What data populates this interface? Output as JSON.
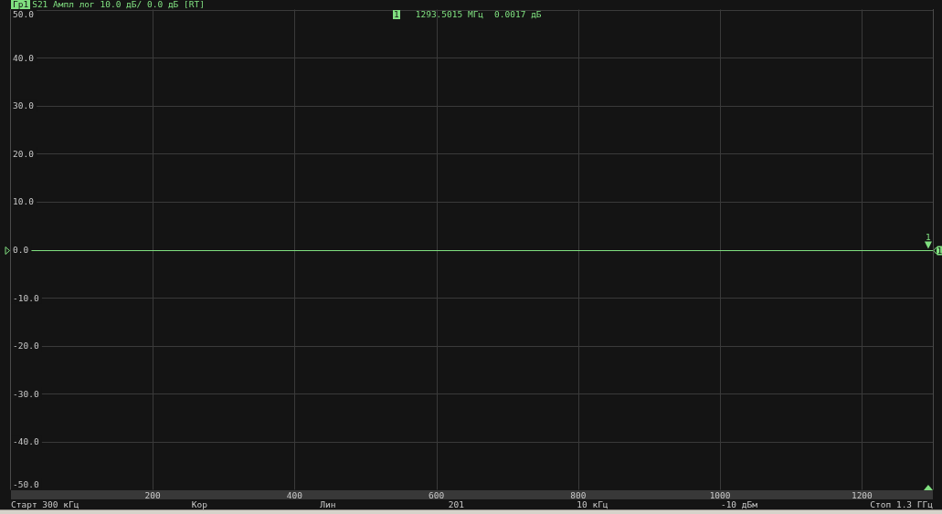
{
  "header": {
    "channel": "Гр1",
    "trace": "S21 Ампл лог 10.0 дБ/ 0.0 дБ [RT]"
  },
  "marker_readout": {
    "marker": "1",
    "stimulus": "1293.5015 МГц",
    "response": "0.0017 дБ"
  },
  "plot": {
    "chart_data": {
      "type": "line",
      "x": [
        0.3,
        1300
      ],
      "series": [
        {
          "color": "#80e080",
          "values": [
            0,
            0
          ]
        }
      ],
      "xlim": [
        0.3,
        1300
      ],
      "ylim": [
        -50,
        50
      ],
      "xticks": [
        200,
        400,
        600,
        800,
        1000,
        1200
      ],
      "yticks": [
        {
          "value": 50,
          "label": "50.0"
        },
        {
          "value": 40,
          "label": "40.0"
        },
        {
          "value": 30,
          "label": "30.0"
        },
        {
          "value": 20,
          "label": "20.0"
        },
        {
          "value": 10,
          "label": "10.0"
        },
        {
          "value": 0,
          "label": "0.0"
        },
        {
          "value": -10,
          "label": "-10.0"
        },
        {
          "value": -20,
          "label": "-20.0"
        },
        {
          "value": -30,
          "label": "-30.0"
        },
        {
          "value": -40,
          "label": "-40.0"
        },
        {
          "value": -50,
          "label": "-50.0"
        }
      ],
      "grid": true,
      "annotations": [
        {
          "text": "1",
          "x": 1293.5015,
          "y": 0.0017
        }
      ]
    },
    "trace_tag": "1"
  },
  "status_bar": [
    "Старт 300 кГц",
    "Кор",
    "Лин",
    "201",
    "10 кГц",
    "-10 дБм",
    "Стоп 1.3 ГГц"
  ]
}
